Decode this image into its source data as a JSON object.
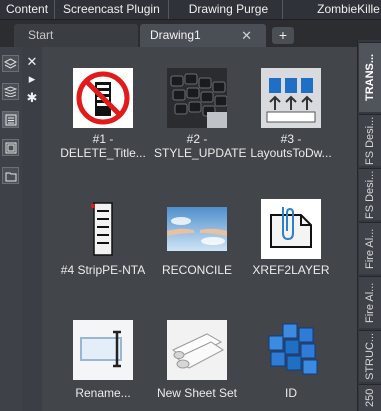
{
  "ribbon": {
    "tabs": [
      "Content",
      "Screencast Plugin",
      "Drawing Purge",
      "ZombieKille"
    ]
  },
  "document_tabs": {
    "start_label": "Start",
    "active_label": "Drawing1",
    "close_glyph": "✕",
    "add_glyph": "+"
  },
  "palette_controls": {
    "close_glyph": "✕",
    "autohide_glyph": "▸",
    "properties_glyph": "✱"
  },
  "tools": [
    {
      "label": "#1 - DELETE_Title...",
      "icon": "no-entry-document-icon"
    },
    {
      "label": "#2 - STYLE_UPDATE",
      "icon": "keyboard-photo-icon"
    },
    {
      "label": "#3 - LayoutsToDw...",
      "icon": "dwg-layouts-icon"
    },
    {
      "label": "#4 StripPE-NTA",
      "icon": "document-stack-icon"
    },
    {
      "label": "RECONCILE",
      "icon": "handshake-icon"
    },
    {
      "label": "XREF2LAYER",
      "icon": "paperclip-document-icon"
    },
    {
      "label": "Rename...",
      "icon": "rename-field-icon"
    },
    {
      "label": "New Sheet Set",
      "icon": "rolled-sheets-icon"
    },
    {
      "label": "ID",
      "icon": "blue-cubes-icon"
    }
  ],
  "side_tabs": [
    "TRANS...",
    "FS Desi...",
    "FS Desi...",
    "Fire Al...",
    "Fire Al...",
    "STRUC...",
    "250"
  ],
  "colors": {
    "background": "#3b3e45",
    "tab_active": "#50545b",
    "dwg_blue": "#1f6fc4",
    "sky_blue": "#6aa7d8"
  }
}
